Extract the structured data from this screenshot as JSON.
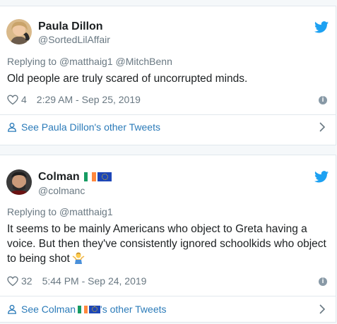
{
  "tweets": [
    {
      "author_name": "Paula Dillon",
      "author_handle": "@SortedLilAffair",
      "replying_prefix": "Replying to ",
      "replying_mentions": "@matthaig1 @MitchBenn",
      "text": "Old people are truly scared of uncorrupted minds.",
      "like_count": "4",
      "timestamp": "2:29 AM - Sep 25, 2019",
      "see_more": "See Paula Dillon's other Tweets"
    },
    {
      "author_name": "Colman",
      "author_handle": "@colmanc",
      "replying_prefix": "Replying to ",
      "replying_mentions": "@matthaig1",
      "text": "It seems to be mainly Americans who object to Greta having a voice. But then they've consistently ignored schoolkids who object to being shot",
      "like_count": "32",
      "timestamp": "5:44 PM - Sep 24, 2019",
      "see_more_prefix": "See Colman",
      "see_more_suffix": "'s other Tweets"
    }
  ],
  "colors": {
    "link": "#2b7bb9",
    "twitter_blue": "#1da1f2",
    "muted": "#697882",
    "border": "#e1e8ed"
  },
  "icons": {
    "brand": "twitter-bird-icon",
    "like": "heart-icon",
    "info": "info-icon",
    "profile": "person-icon",
    "chevron": "chevron-right-icon",
    "flags": [
      "ireland-flag-icon",
      "eu-flag-icon"
    ],
    "emoji": "man-shrugging-emoji-icon"
  }
}
